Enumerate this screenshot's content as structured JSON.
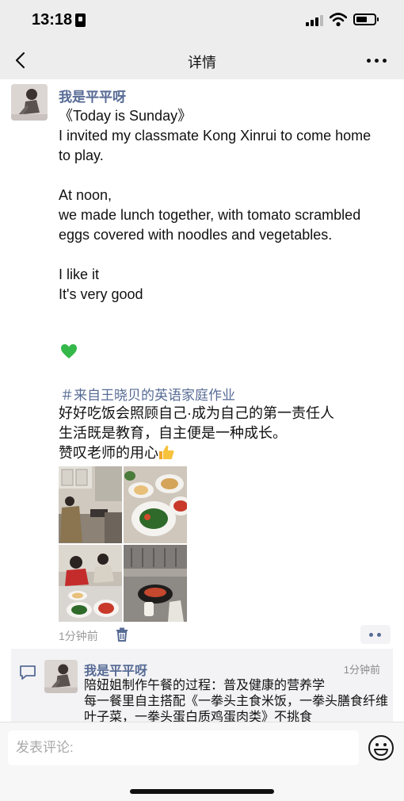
{
  "status_bar": {
    "time": "13:18"
  },
  "nav": {
    "title": "详情"
  },
  "post": {
    "author": "我是平平呀",
    "text": "《Today is Sunday》\nI invited my classmate Kong Xinrui to come home to play.\n\nAt noon,\nwe made lunch together, with tomato scrambled eggs covered with noodles and vegetables.\n\nI like it\nIt's very good",
    "emoji": "green-heart-emoji",
    "tag": "＃来自王晓贝的英语家庭作业",
    "cn_lines": [
      "好好吃饭会照顾自己·成为自己的第一责任人",
      "生活既是教育，自主便是一种成长。"
    ],
    "cn_last": "赞叹老师的用心",
    "photos": [
      "kitchen-cooking-photo",
      "food-table-photo",
      "children-eating-photo",
      "stove-pan-photo"
    ],
    "time": "1分钟前"
  },
  "comment": {
    "author": "我是平平呀",
    "time": "1分钟前",
    "text": "陪妞姐制作午餐的过程：普及健康的营养学\n每一餐里自主搭配《一拳头主食米饭，一拳头膳食纤维叶子菜，一拳头蛋白质鸡蛋肉类》不挑食"
  },
  "input": {
    "placeholder": "发表评论:"
  },
  "colors": {
    "link": "#576b95",
    "background": "#ededed"
  }
}
